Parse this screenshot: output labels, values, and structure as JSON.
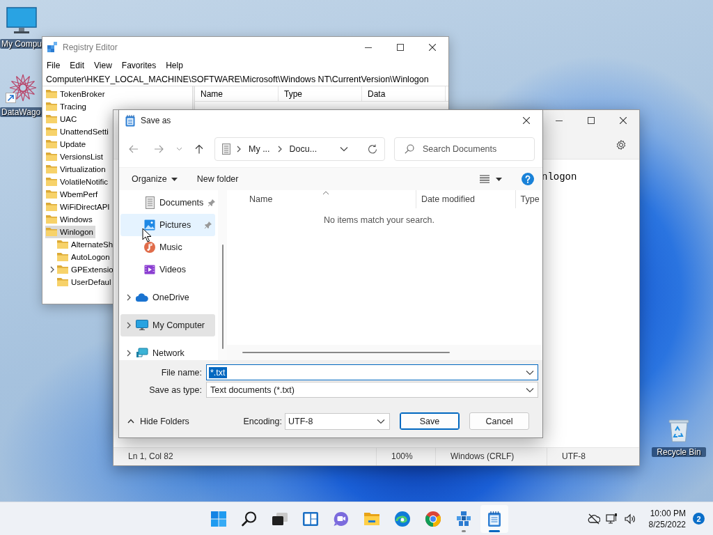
{
  "desktop": {
    "icons": [
      {
        "label": "My Compu",
        "kind": "computer"
      },
      {
        "label": "DataWago",
        "kind": "app"
      },
      {
        "label": "Recycle Bin",
        "kind": "bin"
      }
    ]
  },
  "registry_editor": {
    "title": "Registry Editor",
    "menu": [
      "File",
      "Edit",
      "View",
      "Favorites",
      "Help"
    ],
    "address": "Computer\\HKEY_LOCAL_MACHINE\\SOFTWARE\\Microsoft\\Windows NT\\CurrentVersion\\Winlogon",
    "tree": [
      {
        "label": "TokenBroker",
        "selected": false
      },
      {
        "label": "Tracing",
        "selected": false
      },
      {
        "label": "UAC",
        "selected": false
      },
      {
        "label": "UnattendSetti",
        "selected": false
      },
      {
        "label": "Update",
        "selected": false
      },
      {
        "label": "VersionsList",
        "selected": false
      },
      {
        "label": "Virtualization",
        "selected": false
      },
      {
        "label": "VolatileNotific",
        "selected": false
      },
      {
        "label": "WbemPerf",
        "selected": false
      },
      {
        "label": "WiFiDirectAPI",
        "selected": false
      },
      {
        "label": "Windows",
        "selected": false
      },
      {
        "label": "Winlogon",
        "selected": true,
        "children": [
          {
            "label": "AlternateSh",
            "selected": false,
            "collapsed": false
          },
          {
            "label": "AutoLogon",
            "selected": false,
            "collapsed": false
          },
          {
            "label": "GPExtensio",
            "selected": false,
            "collapsed": true
          },
          {
            "label": "UserDefaul",
            "selected": false,
            "collapsed": false
          }
        ]
      }
    ],
    "columns": [
      "Name",
      "Type",
      "Data"
    ]
  },
  "notepad": {
    "text": "nlogon",
    "status_bar": [
      "Ln 1, Col 82",
      "100%",
      "Windows (CRLF)",
      "UTF-8"
    ]
  },
  "save_dialog": {
    "title": "Save as",
    "breadcrumb": [
      "My ...",
      "Docu..."
    ],
    "search": {
      "placeholder": "Search Documents"
    },
    "organize": "Organize",
    "new_folder": "New folder",
    "nav_pane": [
      {
        "label": "Documents",
        "kind": "documents",
        "pinned": true,
        "hover": false,
        "selected": false,
        "expandable": false
      },
      {
        "label": "Pictures",
        "kind": "pictures",
        "pinned": true,
        "hover": true,
        "selected": false,
        "expandable": false
      },
      {
        "label": "Music",
        "kind": "music",
        "pinned": false,
        "hover": false,
        "selected": false,
        "expandable": false
      },
      {
        "label": "Videos",
        "kind": "videos",
        "pinned": false,
        "hover": false,
        "selected": false,
        "expandable": false
      },
      {
        "label": "OneDrive",
        "kind": "onedrive",
        "pinned": false,
        "hover": false,
        "selected": false,
        "expandable": true
      },
      {
        "label": "My Computer",
        "kind": "computer",
        "pinned": false,
        "hover": false,
        "selected": true,
        "expandable": true
      },
      {
        "label": "Network",
        "kind": "network",
        "pinned": false,
        "hover": false,
        "selected": false,
        "expandable": true
      }
    ],
    "columns": [
      "Name",
      "Date modified",
      "Type"
    ],
    "empty_message": "No items match your search.",
    "file_name": {
      "label": "File name:",
      "value": "*.txt",
      "selected": true
    },
    "save_as_type": {
      "label": "Save as type:",
      "value": "Text documents (*.txt)"
    },
    "hide_folders": "Hide Folders",
    "encoding": {
      "label": "Encoding:",
      "value": "UTF-8"
    },
    "buttons": [
      "Save",
      "Cancel"
    ]
  },
  "taskbar": {
    "apps": [
      {
        "kind": "start",
        "running": false,
        "active": false
      },
      {
        "kind": "search",
        "running": false,
        "active": false
      },
      {
        "kind": "task_view",
        "running": false,
        "active": false
      },
      {
        "kind": "widgets",
        "running": false,
        "active": false
      },
      {
        "kind": "chat",
        "running": false,
        "active": false
      },
      {
        "kind": "explorer",
        "running": false,
        "active": false
      },
      {
        "kind": "edge",
        "running": false,
        "active": false
      },
      {
        "kind": "chrome",
        "running": false,
        "active": false
      },
      {
        "kind": "app",
        "running": true,
        "active": false
      },
      {
        "kind": "notepad",
        "running": true,
        "active": true
      }
    ],
    "time": "10:00 PM",
    "date": "8/25/2022",
    "notifications": "2"
  }
}
